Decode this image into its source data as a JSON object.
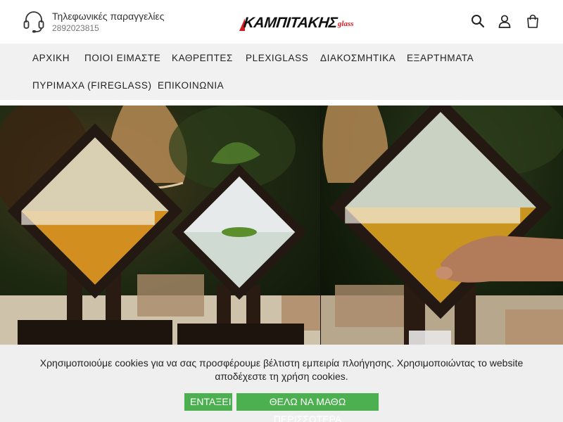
{
  "header": {
    "phone_label": "Τηλεφωνικές παραγγελίες",
    "phone_number": "2892023815",
    "logo_text": "ΚΑΜΠΙΤΑΚΗΣ",
    "logo_sub": "glass",
    "icons": [
      "headset-icon",
      "search-icon",
      "user-icon",
      "cart-icon"
    ]
  },
  "nav": {
    "items": [
      {
        "label": "ΑΡΧΙΚΗ"
      },
      {
        "label": "ΠΟΙΟΙ ΕΙΜΑΣΤΕ"
      },
      {
        "label": "ΚΑΘΡΕΠΤΕΣ"
      },
      {
        "label": "PLEXIGLASS"
      },
      {
        "label": "ΔΙΑΚΟΣΜΗΤΙΚΑ"
      },
      {
        "label": "ΕΞΑΡΤΗΜΑΤΑ"
      },
      {
        "label": "ΠΥΡΙΜΑΧΑ (FIREGLASS)"
      },
      {
        "label": "ΕΠΙΚΟΙΝΩΝΙΑ"
      }
    ]
  },
  "cookie": {
    "text": "Χρησιμοποιούμε cookies για να σας προσφέρουμε βέλτιστη εμπειρία πλοήγησης. Χρησιμοποιώντας το website αποδέχεστε τη χρήση cookies.",
    "accept_label": "ΕΝΤΑΞΕΙ",
    "more_label": "ΘΕΛΩ ΝΑ ΜΑΘΩ ΠΕΡΙΣΣΟΤΕΡΑ"
  },
  "colors": {
    "brand_red": "#d71920",
    "cookie_button": "#4caf50",
    "nav_bg": "#f1f1f1"
  }
}
